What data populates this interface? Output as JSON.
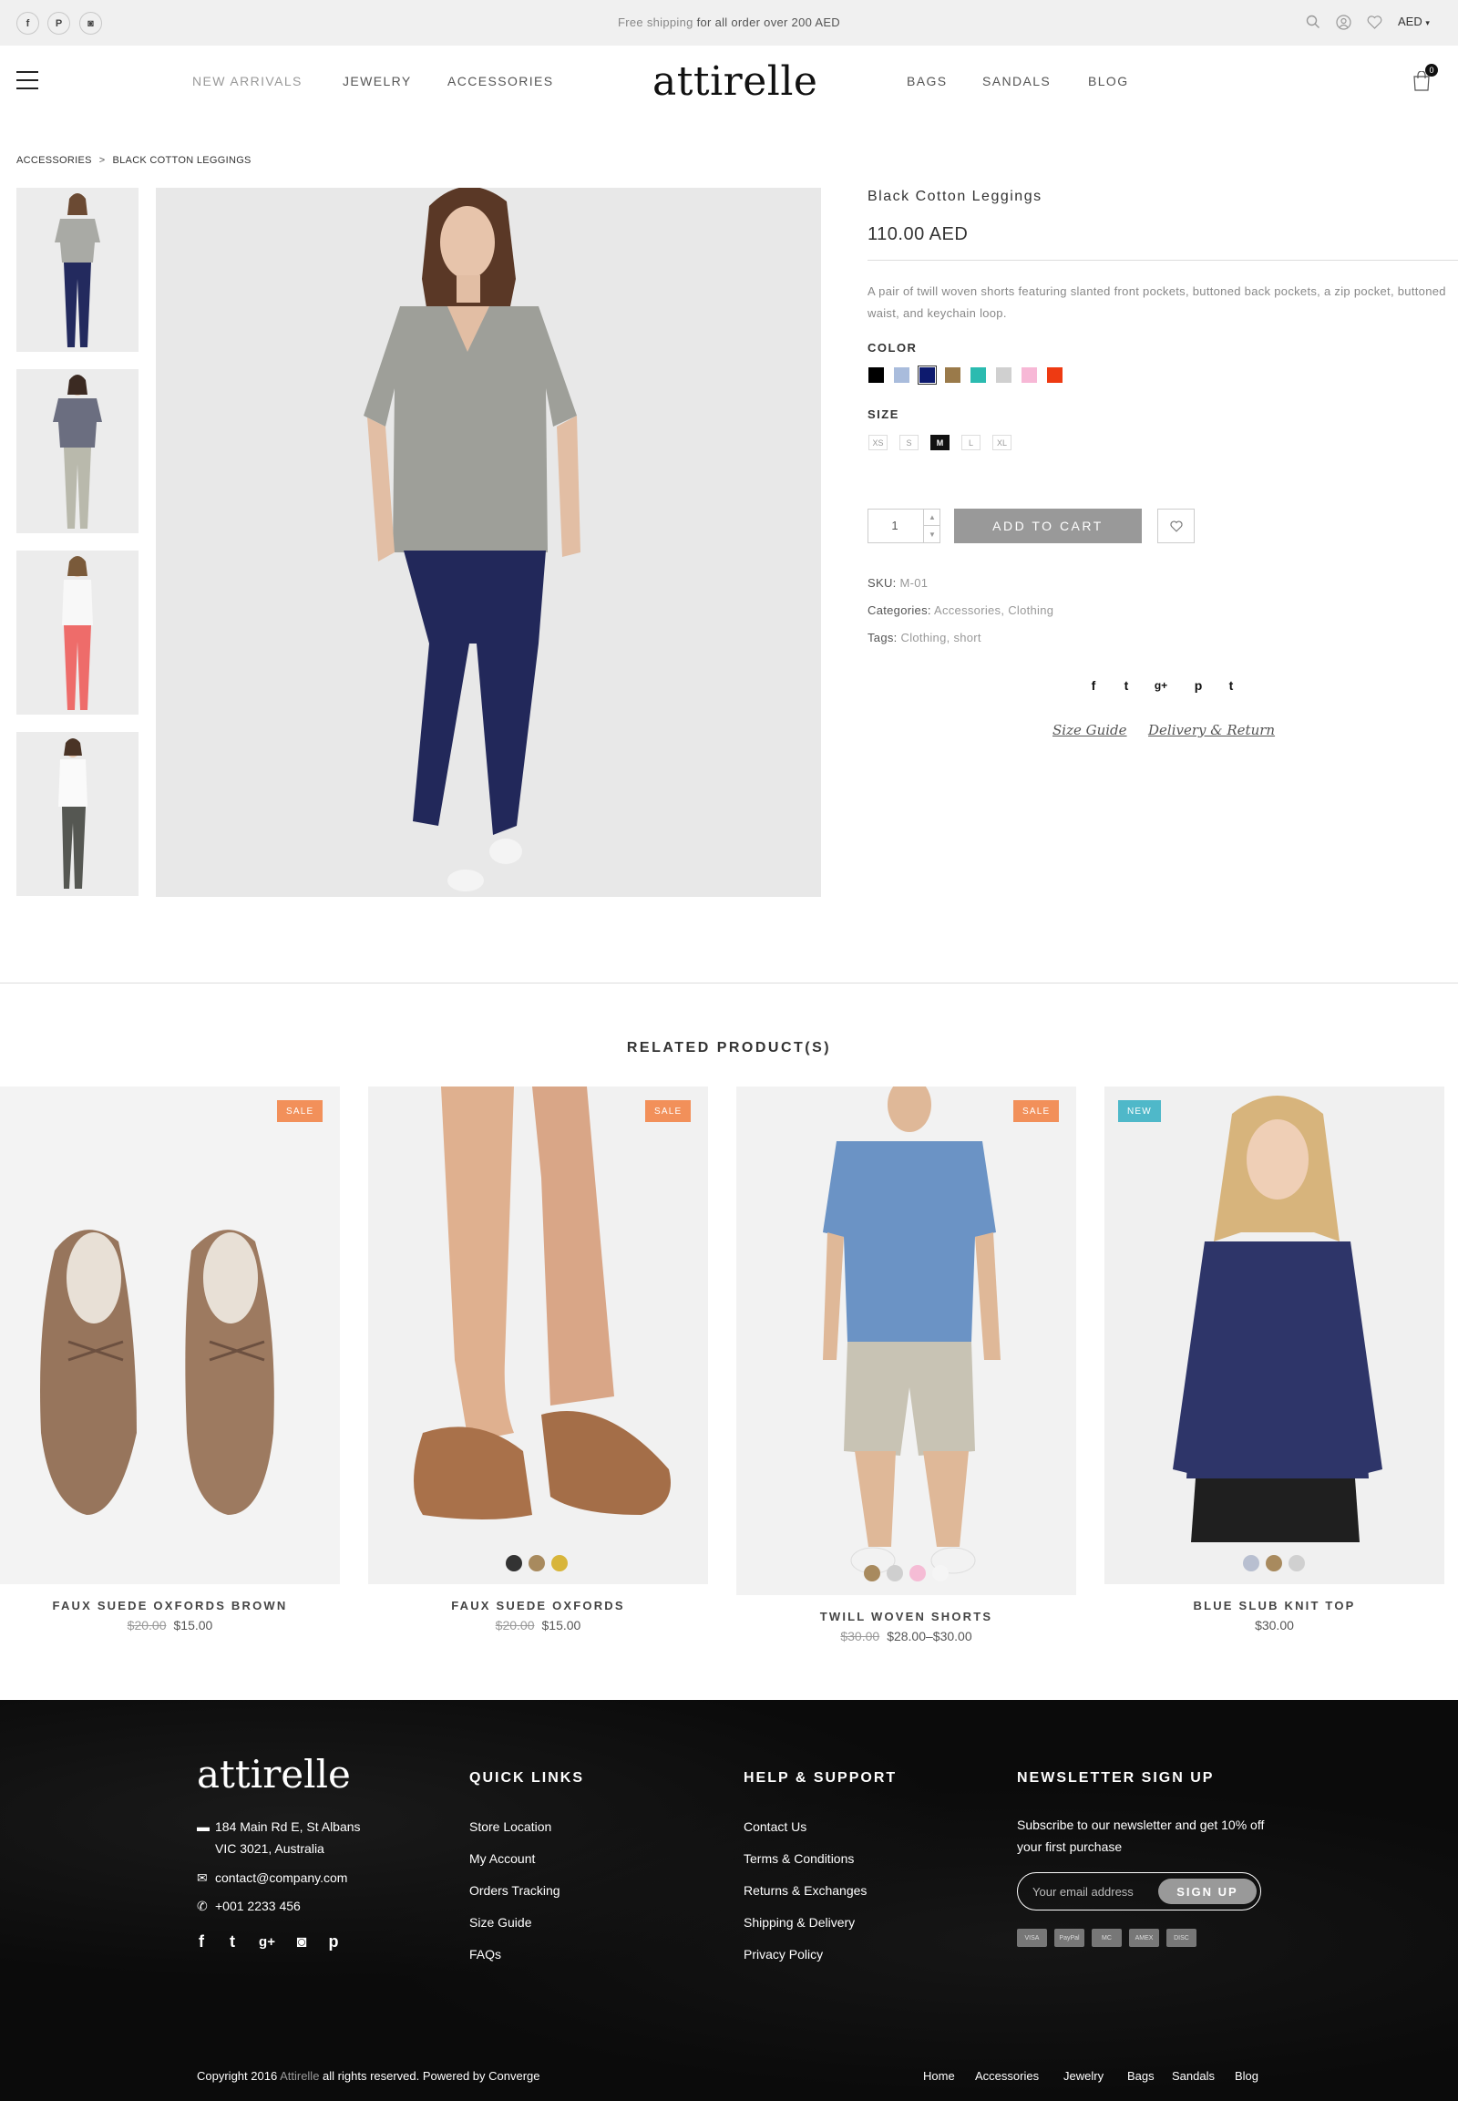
{
  "topbar": {
    "social": [
      {
        "icon": "facebook-icon",
        "glyph": "f"
      },
      {
        "icon": "pinterest-icon",
        "glyph": "P"
      },
      {
        "icon": "instagram-icon",
        "glyph": "◙"
      }
    ],
    "shipping_highlight": "Free shipping",
    "shipping_rest": " for all order over 200 AED",
    "currency": "AED"
  },
  "nav": {
    "left": [
      "NEW ARRIVALS",
      "JEWELRY",
      "ACCESSORIES"
    ],
    "right": [
      "BAGS",
      "SANDALS",
      "BLOG"
    ],
    "logo": "attirelle",
    "cart_count": "0"
  },
  "breadcrumb": {
    "parent": "ACCESSORIES",
    "separator": ">",
    "current": "BLACK COTTON LEGGINGS"
  },
  "product": {
    "title": "Black Cotton Leggings",
    "price": "110.00 AED",
    "description": "A pair of twill woven shorts featuring slanted front pockets, buttoned back pockets, a zip pocket, buttoned waist, and keychain loop.",
    "color_label": "COLOR",
    "colors": [
      "#000000",
      "#a9bcdc",
      "#0d1a6e",
      "#9a7a4a",
      "#2bbbb0",
      "#d0d0d0",
      "#f7b8d6",
      "#ee3a12"
    ],
    "selected_color_index": 2,
    "size_label": "SIZE",
    "sizes": [
      "XS",
      "S",
      "M",
      "L",
      "XL"
    ],
    "selected_size_index": 2,
    "quantity": "1",
    "add_to_cart": "ADD TO CART",
    "sku_label": "SKU:",
    "sku": "M-01",
    "categories_label": "Categories:",
    "categories": [
      "Accessories",
      "Clothing"
    ],
    "tags_label": "Tags:",
    "tags": [
      "Clothing",
      "short"
    ],
    "share": [
      {
        "icon": "facebook-icon",
        "glyph": "f"
      },
      {
        "icon": "twitter-icon",
        "glyph": "t"
      },
      {
        "icon": "google-plus-icon",
        "glyph": "g+"
      },
      {
        "icon": "pinterest-icon",
        "glyph": "p"
      },
      {
        "icon": "tumblr-icon",
        "glyph": "t"
      }
    ],
    "size_guide": "Size Guide",
    "delivery_return": "Delivery & Return"
  },
  "related": {
    "title": "RELATED PRODUCT(S)",
    "items": [
      {
        "name": "FAUX SUEDE OXFORDS BROWN",
        "old_price": "$20.00",
        "price": "$15.00",
        "badge": "SALE",
        "swatches": []
      },
      {
        "name": "FAUX SUEDE OXFORDS",
        "old_price": "$20.00",
        "price": "$15.00",
        "badge": "SALE",
        "swatches": [
          "#333333",
          "#a88a5e",
          "#d8b53a"
        ]
      },
      {
        "name": "TWILL WOVEN SHORTS",
        "old_price": "$30.00",
        "price": "$28.00–$30.00",
        "badge": "SALE",
        "swatches": [
          "#a88a5e",
          "#cfcfcf",
          "#f5bcd5",
          "#f5f5f5"
        ]
      },
      {
        "name": "BLUE SLUB KNIT TOP",
        "old_price": "",
        "price": "$30.00",
        "badge": "NEW",
        "swatches": [
          "#b8bfd0",
          "#a88a5e",
          "#d0d0d0"
        ]
      }
    ]
  },
  "footer": {
    "logo": "attirelle",
    "address_line1": "184 Main Rd E, St Albans",
    "address_line2": "VIC 3021, Australia",
    "email": "contact@company.com",
    "phone": "+001 2233 456",
    "quick_links_title": "QUICK LINKS",
    "quick_links": [
      "Store Location",
      "My Account",
      "Orders Tracking",
      "Size Guide",
      "FAQs"
    ],
    "help_title": "HELP & SUPPORT",
    "help_links": [
      "Contact Us",
      "Terms & Conditions",
      "Returns & Exchanges",
      "Shipping & Delivery",
      "Privacy Policy"
    ],
    "newsletter_title": "NEWSLETTER SIGN UP",
    "newsletter_text": "Subscribe to our newsletter and get 10% off your first purchase",
    "newsletter_placeholder": "Your email address",
    "newsletter_button": "SIGN UP",
    "payment": [
      "VISA",
      "PayPal",
      "MC",
      "AMEX",
      "DISC"
    ],
    "copyright_prefix": "Copyright 2016 ",
    "copyright_brand": "Attirelle",
    "copyright_suffix": " all rights reserved. Powered by Converge",
    "bottom_links": [
      "Home",
      "Accessories",
      "Jewelry",
      "Bags",
      "Sandals",
      "Blog"
    ]
  }
}
